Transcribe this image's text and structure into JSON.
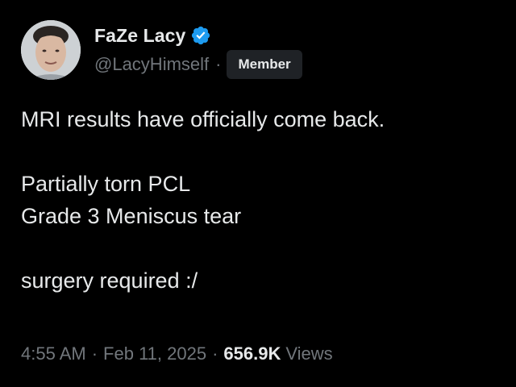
{
  "author": {
    "display_name": "FaZe Lacy",
    "handle": "@LacyHimself",
    "separator": "·",
    "badge": "Member",
    "verified_icon": "verified-badge-icon",
    "avatar": "profile-photo"
  },
  "tweet": {
    "text": "MRI results have officially come back.\n\nPartially torn PCL\nGrade 3 Meniscus tear\n\nsurgery required :/"
  },
  "meta": {
    "time": "4:55 AM",
    "dot1": "·",
    "date": "Feb 11, 2025",
    "dot2": "·",
    "views_count": "656.9K",
    "views_label": "Views"
  },
  "colors": {
    "background": "#000000",
    "primary_text": "#e7e9ea",
    "secondary_text": "#71767b",
    "verified_blue": "#1d9bf0",
    "badge_bg": "#1f2226"
  }
}
